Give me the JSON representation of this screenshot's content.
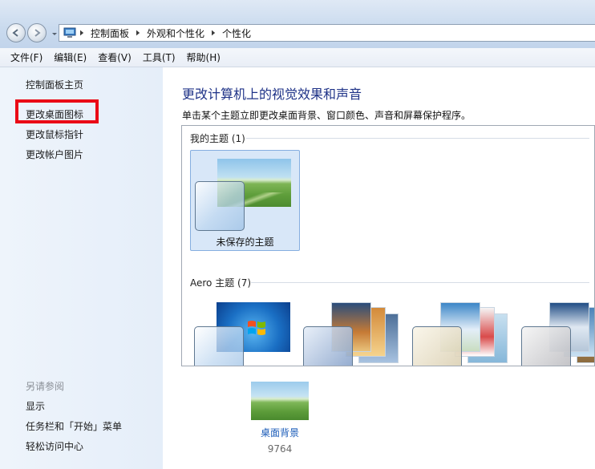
{
  "breadcrumb": {
    "items": [
      "控制面板",
      "外观和个性化",
      "个性化"
    ]
  },
  "menubar": {
    "items": [
      "文件(F)",
      "编辑(E)",
      "查看(V)",
      "工具(T)",
      "帮助(H)"
    ]
  },
  "left_pane": {
    "links": [
      "控制面板主页",
      "更改桌面图标",
      "更改鼠标指针",
      "更改帐户图片"
    ],
    "see_also_heading": "另请参阅",
    "see_also_links": [
      "显示",
      "任务栏和「开始」菜单",
      "轻松访问中心"
    ]
  },
  "main": {
    "title": "更改计算机上的视觉效果和声音",
    "description": "单击某个主题立即更改桌面背景、窗口颜色、声音和屏幕保护程序。"
  },
  "themes": {
    "my_themes_label": "我的主题 (1)",
    "unsaved_theme_name": "未保存的主题",
    "aero_label": "Aero 主题 (7)"
  },
  "bottom": {
    "desktop_background_label": "桌面背景",
    "desktop_background_value": "9764"
  },
  "colors": {
    "title_blue": "#1e3287",
    "highlight_red": "#ea0a16",
    "link_blue": "#1a5bb8"
  },
  "icons": {
    "back": "back-arrow-icon",
    "forward": "forward-arrow-icon",
    "control_panel": "control-panel-icon"
  }
}
